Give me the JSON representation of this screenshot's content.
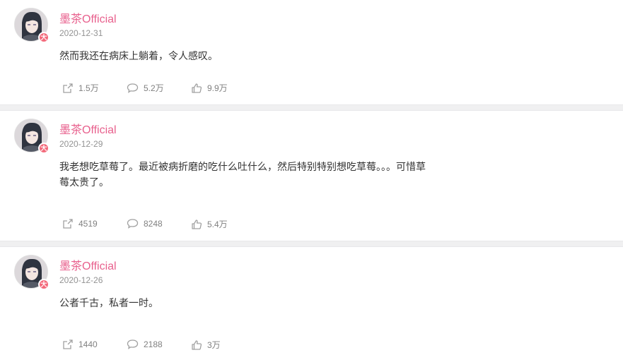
{
  "posts": [
    {
      "username": "墨茶Official",
      "badge": "大",
      "date": "2020-12-31",
      "content": "然而我还在病床上躺着，令人感叹。",
      "shares": "1.5万",
      "comments": "5.2万",
      "likes": "9.9万"
    },
    {
      "username": "墨茶Official",
      "badge": "大",
      "date": "2020-12-29",
      "content": "我老想吃草莓了。最近被病折磨的吃什么吐什么，然后特别特别想吃草莓。。。可惜草莓太贵了。",
      "shares": "4519",
      "comments": "8248",
      "likes": "5.4万"
    },
    {
      "username": "墨茶Official",
      "badge": "大",
      "date": "2020-12-26",
      "content": "公者千古，私者一时。",
      "shares": "1440",
      "comments": "2188",
      "likes": "3万"
    }
  ],
  "icons": {
    "share": "share-icon",
    "comment": "comment-icon",
    "like": "thumbs-up-icon"
  },
  "colors": {
    "username": "#e8608d",
    "meta": "#939393",
    "action": "#808080",
    "separator": "#f0f0f1"
  }
}
